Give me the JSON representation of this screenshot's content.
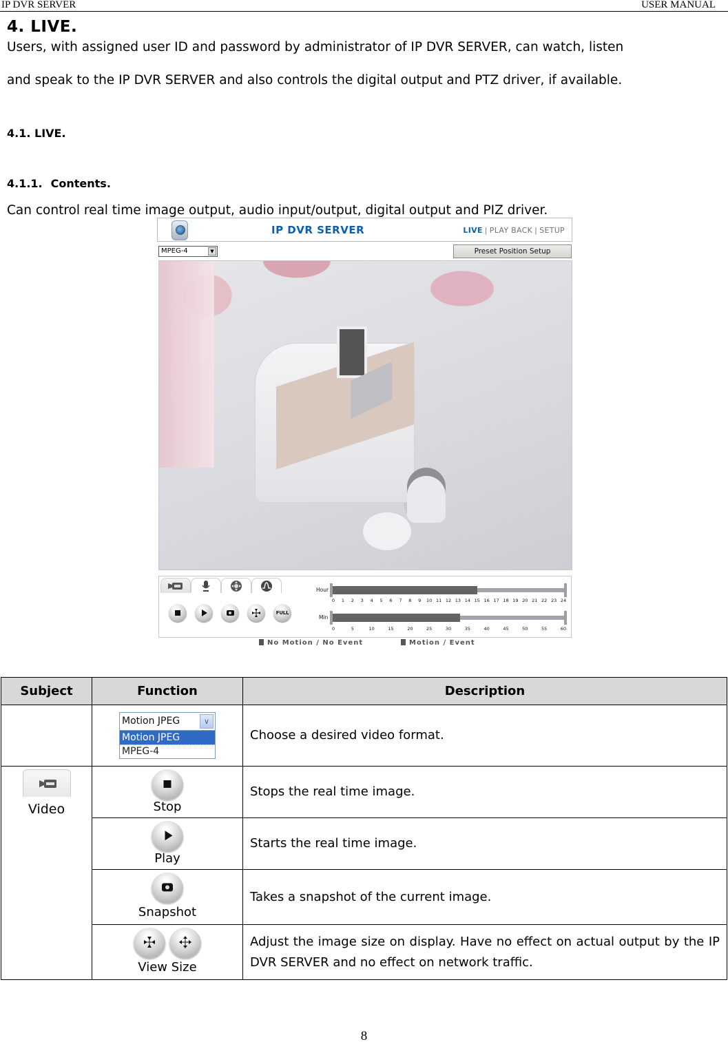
{
  "page_header": {
    "left": "IP DVR SERVER",
    "right": "USER MANUAL"
  },
  "section": {
    "title": "4. LIVE.",
    "intro_line1": "Users, with assigned user ID and password by administrator of IP DVR SERVER, can watch, listen",
    "intro_line2": "and speak to the IP DVR SERVER and also controls the digital output and PTZ driver, if available.",
    "subsection_title": "4.1. LIVE.",
    "subsubsection_number": "4.1.1.",
    "subsubsection_title": "Contents.",
    "contents_text": "Can control real time image output, audio input/output, digital output and PIZ driver."
  },
  "app": {
    "title": "IP DVR SERVER",
    "nav": [
      {
        "label": "LIVE",
        "active": true
      },
      {
        "label": "PLAY BACK",
        "active": false
      },
      {
        "label": "SETUP",
        "active": false
      }
    ],
    "nav_separator": "|",
    "format_select_value": "MPEG-4",
    "preset_button": "Preset Position Setup",
    "tabs": [
      {
        "icon": "video-camera-icon",
        "active": true
      },
      {
        "icon": "microphone-icon",
        "active": false
      },
      {
        "icon": "ptz-direction-icon",
        "active": false
      },
      {
        "icon": "digital-output-icon",
        "active": false
      }
    ],
    "controls": [
      {
        "icon": "stop-icon",
        "label": ""
      },
      {
        "icon": "play-icon",
        "label": ""
      },
      {
        "icon": "snapshot-icon",
        "label": ""
      },
      {
        "icon": "view-size-icon",
        "label": ""
      },
      {
        "icon": "fullscreen-icon",
        "label": "FULL"
      }
    ],
    "timeline": {
      "hour": {
        "label": "Hour",
        "ticks": [
          "0",
          "1",
          "2",
          "3",
          "4",
          "5",
          "6",
          "7",
          "8",
          "9",
          "10",
          "11",
          "12",
          "13",
          "14",
          "15",
          "16",
          "17",
          "18",
          "19",
          "20",
          "21",
          "22",
          "23",
          "24"
        ],
        "max": 24,
        "progress": 15
      },
      "min": {
        "label": "Min",
        "ticks": [
          "0",
          "5",
          "10",
          "15",
          "20",
          "25",
          "30",
          "35",
          "40",
          "45",
          "50",
          "55",
          "60"
        ],
        "max": 60,
        "progress": 33
      }
    },
    "legend": [
      {
        "label": "No Motion / No Event",
        "color": "#555555"
      },
      {
        "label": "Motion / Event",
        "color": "#555555"
      }
    ],
    "colors": {
      "brand_blue": "#0d5fae",
      "timeline_fill": "#636363",
      "timeline_track": "#a4a3ab"
    }
  },
  "table": {
    "headers": {
      "subject": "Subject",
      "function": "Function",
      "description": "Description"
    },
    "format_row": {
      "dropdown_value": "Motion JPEG",
      "dropdown_options": [
        "Motion JPEG",
        "MPEG-4"
      ],
      "highlighted_option": "Motion JPEG",
      "description": "Choose a desired video format."
    },
    "video_subject": "Video",
    "rows": [
      {
        "function": "Stop",
        "description": "Stops the real time image."
      },
      {
        "function": "Play",
        "description": "Starts the real time image."
      },
      {
        "function": "Snapshot",
        "description": "Takes a snapshot of the current image."
      },
      {
        "function": "View Size",
        "description": "Adjust the image size on display. Have no effect on actual output by the IP DVR SERVER and no effect on network traffic."
      }
    ]
  },
  "page_number": "8"
}
